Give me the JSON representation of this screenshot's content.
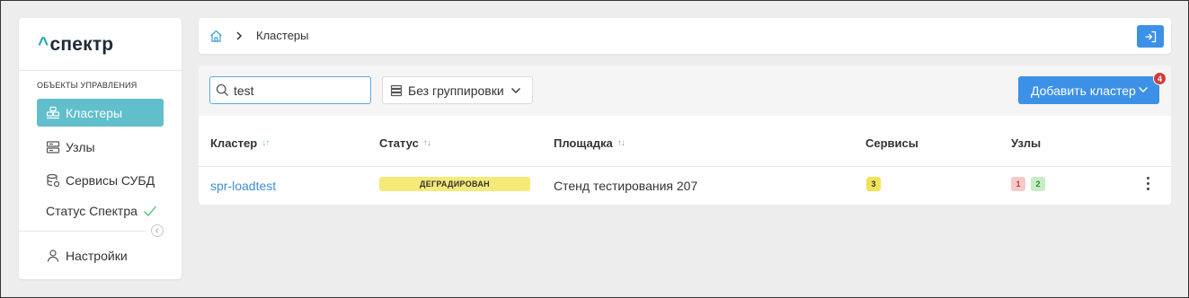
{
  "app": {
    "logo_caret": "^",
    "logo_text": "спектр"
  },
  "sidebar": {
    "section_title": "ОБЪЕКТЫ УПРАВЛЕНИЯ",
    "items": [
      {
        "label": "Кластеры",
        "icon": "clusters-icon",
        "active": true
      },
      {
        "label": "Узлы",
        "icon": "server-icon",
        "active": false
      },
      {
        "label": "Сервисы СУБД",
        "icon": "database-service-icon",
        "active": false
      },
      {
        "label": "Статус Спектра",
        "icon": "check-icon",
        "active": false
      }
    ],
    "settings_label": "Настройки"
  },
  "header": {
    "breadcrumb": "Кластеры"
  },
  "toolbar": {
    "search_value": "test",
    "grouping_label": "Без группировки",
    "add_button_label": "Добавить кластер",
    "notification_count": "4"
  },
  "table": {
    "columns": [
      {
        "label": "Кластер",
        "sort": "↓↑"
      },
      {
        "label": "Статус",
        "sort": "↑↓"
      },
      {
        "label": "Площадка",
        "sort": "↑↓"
      },
      {
        "label": "Сервисы",
        "sort": ""
      },
      {
        "label": "Узлы",
        "sort": ""
      }
    ],
    "rows": [
      {
        "cluster": "spr-loadtest",
        "status": "ДЕГРАДИРОВАН",
        "site": "Стенд тестирования 207",
        "services": "3",
        "nodes_bad": "1",
        "nodes_ok": "2"
      }
    ]
  },
  "colors": {
    "accent": "#61bfcc",
    "primary": "#3c91e6",
    "status_degraded": "#f5e97a",
    "badge_services": "#f0e25a",
    "badge_nodes_bad": "#f6c9c9",
    "badge_nodes_ok": "#c8ecc8",
    "notification": "#d23b3b"
  }
}
